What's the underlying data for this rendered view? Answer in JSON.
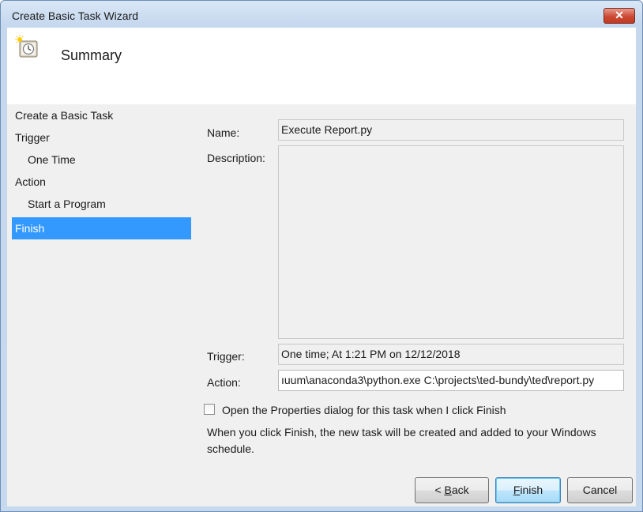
{
  "window": {
    "title": "Create Basic Task Wizard",
    "close_glyph": "✕"
  },
  "header": {
    "title": "Summary",
    "icon": "task-scheduler-icon"
  },
  "nav": {
    "items": [
      {
        "label": "Create a Basic Task",
        "selected": false
      },
      {
        "label": "Trigger",
        "selected": false
      },
      {
        "label": "One Time",
        "selected": false
      },
      {
        "label": "Action",
        "selected": false
      },
      {
        "label": "Start a Program",
        "selected": false
      },
      {
        "label": "Finish",
        "selected": true
      }
    ]
  },
  "form": {
    "name_label": "Name:",
    "name_value": "Execute Report.py",
    "description_label": "Description:",
    "description_value": "",
    "trigger_label": "Trigger:",
    "trigger_value": "One time; At 1:21 PM on 12/12/2018",
    "action_label": "Action:",
    "action_value": "ıuum\\anaconda3\\python.exe C:\\projects\\ted-bundy\\ted\\report.py"
  },
  "options": {
    "open_properties_label": "Open the Properties dialog for this task when I click Finish",
    "open_properties_checked": false,
    "info": "When you click Finish, the new task will be created and added to your Windows schedule."
  },
  "buttons": {
    "back_prefix": "< ",
    "back_mnemonic": "B",
    "back_rest": "ack",
    "finish_mnemonic": "F",
    "finish_rest": "inish",
    "cancel": "Cancel"
  },
  "colors": {
    "selection": "#3399ff",
    "accent_frame": "#c7d9ee"
  }
}
